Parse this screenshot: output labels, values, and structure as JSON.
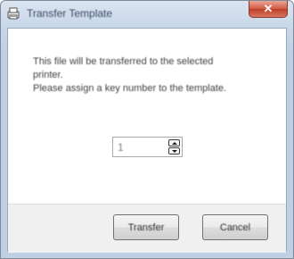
{
  "window": {
    "title": "Transfer Template",
    "close_glyph": "✕",
    "app_icon": "printer-template-icon"
  },
  "message": {
    "line1": "This file will be transferred to the selected",
    "line2": "printer.",
    "line3": "Please assign a key number to the template."
  },
  "key_number": {
    "value": "1"
  },
  "buttons": {
    "transfer_label": "Transfer",
    "cancel_label": "Cancel"
  },
  "colors": {
    "close_button": "#c8442c",
    "frame": "#c8d6e8"
  }
}
